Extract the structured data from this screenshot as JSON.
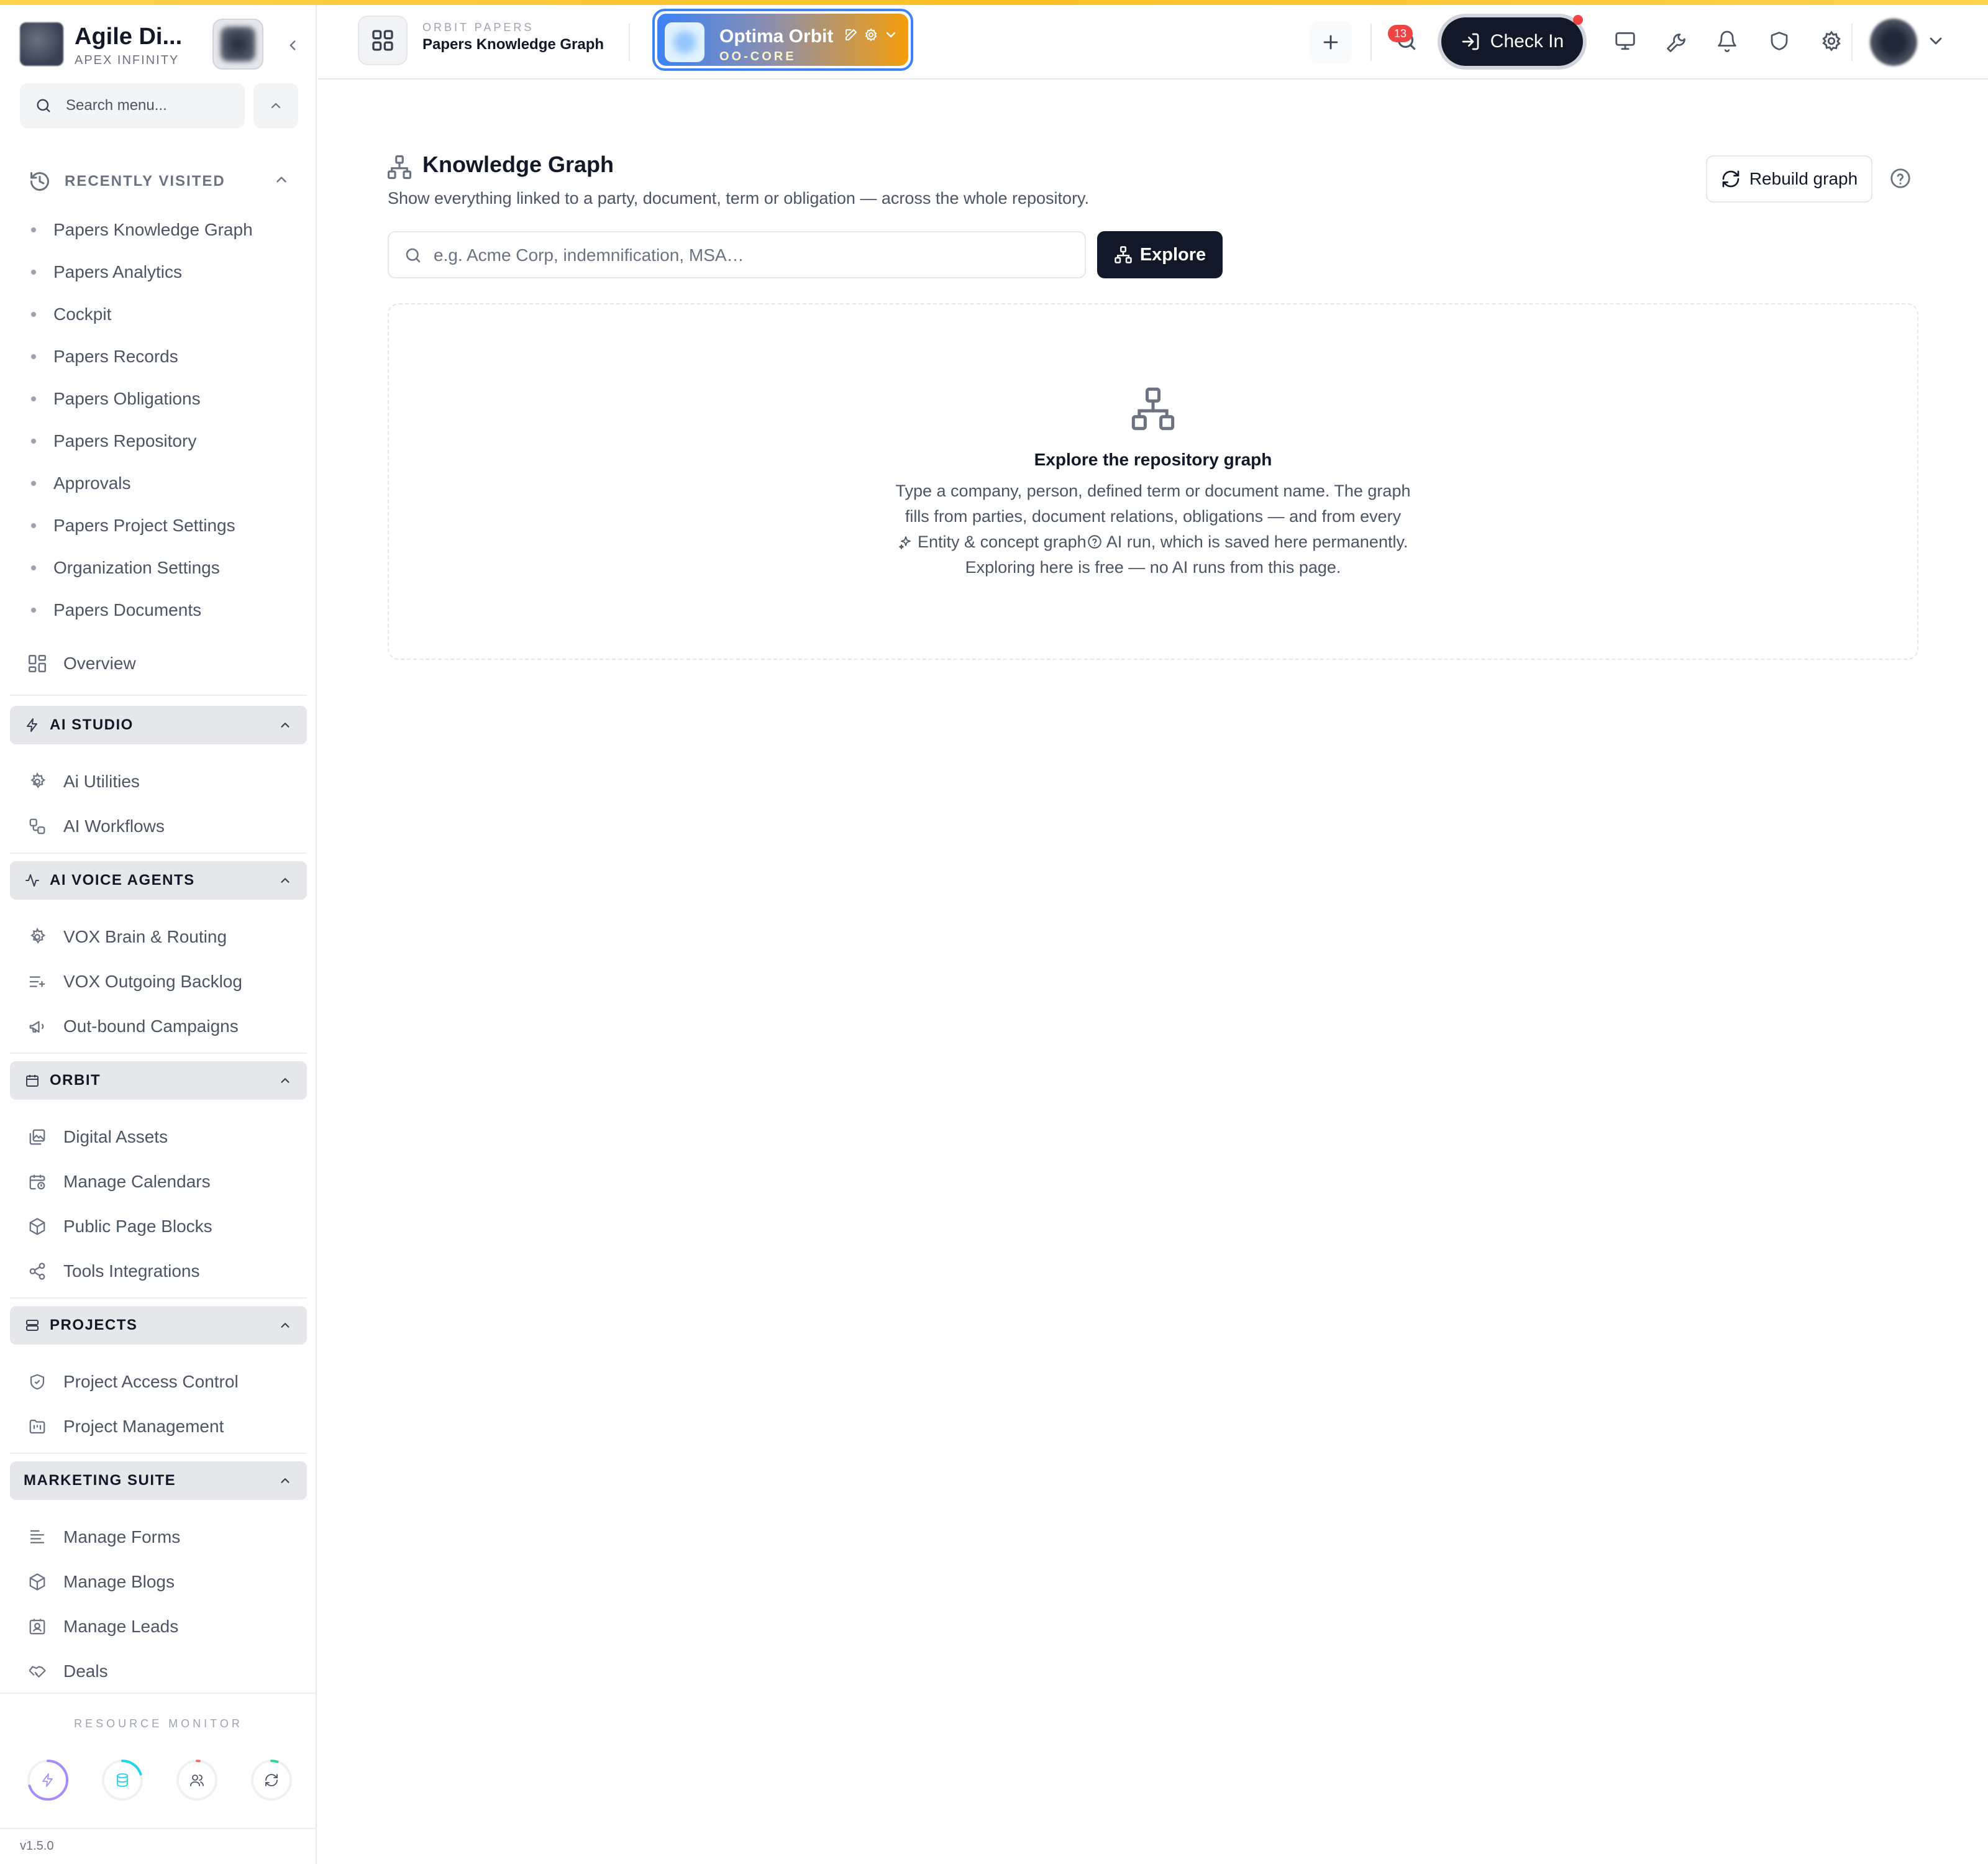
{
  "brand": {
    "name": "Agile Di...",
    "subtitle": "APEX INFINITY"
  },
  "sidebar": {
    "search_placeholder": "Search menu...",
    "recent": {
      "title": "RECENTLY VISITED",
      "items": [
        "Papers Knowledge Graph",
        "Papers Analytics",
        "Cockpit",
        "Papers Records",
        "Papers Obligations",
        "Papers Repository",
        "Approvals",
        "Papers Project Settings",
        "Organization Settings",
        "Papers Documents"
      ]
    },
    "overview_label": "Overview",
    "sections": [
      {
        "title": "AI STUDIO",
        "icon": "bolt-icon",
        "items": [
          {
            "label": "Ai Utilities",
            "icon": "gear-icon"
          },
          {
            "label": "AI Workflows",
            "icon": "workflow-icon"
          }
        ]
      },
      {
        "title": "AI VOICE AGENTS",
        "icon": "activity-icon",
        "items": [
          {
            "label": "VOX Brain & Routing",
            "icon": "gear-icon"
          },
          {
            "label": "VOX Outgoing Backlog",
            "icon": "list-plus-icon"
          },
          {
            "label": "Out-bound Campaigns",
            "icon": "megaphone-icon"
          }
        ]
      },
      {
        "title": "ORBIT",
        "icon": "calendar-icon",
        "items": [
          {
            "label": "Digital Assets",
            "icon": "images-icon"
          },
          {
            "label": "Manage Calendars",
            "icon": "calendar-clock-icon"
          },
          {
            "label": "Public Page Blocks",
            "icon": "box-icon"
          },
          {
            "label": "Tools Integrations",
            "icon": "share-icon"
          }
        ]
      },
      {
        "title": "PROJECTS",
        "icon": "server-icon",
        "items": [
          {
            "label": "Project Access Control",
            "icon": "shield-check-icon"
          },
          {
            "label": "Project Management",
            "icon": "folder-kanban-icon"
          }
        ]
      },
      {
        "title": "MARKETING SUITE",
        "icon": "",
        "items": [
          {
            "label": "Manage Forms",
            "icon": "form-icon"
          },
          {
            "label": "Manage Blogs",
            "icon": "box-icon"
          },
          {
            "label": "Manage Leads",
            "icon": "contact-icon"
          },
          {
            "label": "Deals",
            "icon": "handshake-icon"
          }
        ]
      }
    ],
    "monitor_label": "RESOURCE MONITOR",
    "monitor_gauges": [
      {
        "icon": "bolt-icon",
        "color": "#a78bfa",
        "level": 0.7
      },
      {
        "icon": "database-icon",
        "color": "#22d3ee",
        "level": 0.2
      },
      {
        "icon": "users-icon",
        "color": "#f87171",
        "level": 0.02
      },
      {
        "icon": "refresh-icon",
        "color": "#34d399",
        "level": 0.05
      }
    ],
    "version": "v1.5.0"
  },
  "header": {
    "crumb_top": "ORBIT PAPERS",
    "crumb_title": "Papers Knowledge Graph",
    "project": {
      "name": "Optima Orbit",
      "code": "OO-CORE"
    },
    "checkin_label": "Check In",
    "notification_count": "13"
  },
  "main": {
    "title": "Knowledge Graph",
    "description": "Show everything linked to a party, document, term or obligation — across the whole repository.",
    "rebuild_label": "Rebuild graph",
    "search_placeholder": "e.g. Acme Corp, indemnification, MSA…",
    "explore_label": "Explore",
    "empty": {
      "title": "Explore the repository graph",
      "line1": "Type a company, person, defined term or document name. The graph",
      "line2": "fills from parties, document relations, obligations — and from every",
      "line3a": "Entity & concept graph",
      "line3b": "AI run, which is saved here permanently.",
      "line4": "Exploring here is free — no AI runs from this page."
    }
  },
  "colors": {
    "accent_dark": "#111827",
    "project_border": "#3b82f6",
    "badge": "#ef4444",
    "top_stripe": "#fbbf24"
  }
}
